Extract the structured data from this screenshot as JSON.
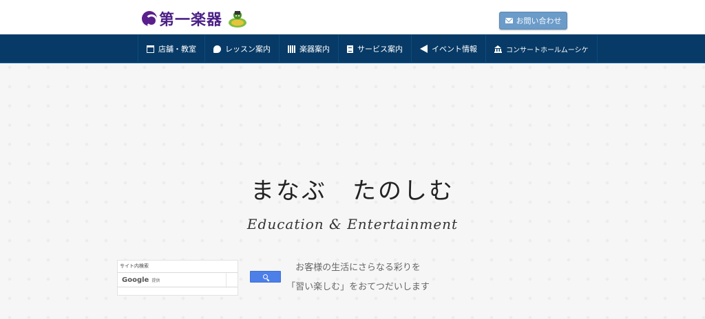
{
  "header": {
    "logo_text": "第一楽器",
    "contact_label": "お問い合わせ"
  },
  "nav": {
    "items": [
      {
        "label": "店舗・教室",
        "icon": "store-icon"
      },
      {
        "label": "レッスン案内",
        "icon": "chat-bubble-icon"
      },
      {
        "label": "楽器案内",
        "icon": "piano-keys-icon"
      },
      {
        "label": "サービス案内",
        "icon": "document-icon"
      },
      {
        "label": "イベント情報",
        "icon": "megaphone-icon"
      },
      {
        "label": "コンサートホールムーシケ",
        "icon": "concert-hall-icon"
      }
    ]
  },
  "hero": {
    "title": "まなぶ　たのしむ",
    "subtitle": "Education & Entertainment",
    "line1": "お客様の生活にさらなる彩りを",
    "line2": "「習い楽しむ」をおてつだいします"
  },
  "search": {
    "caption": "サイト内検索",
    "brand": "Google",
    "provided": "提供"
  },
  "colors": {
    "nav_bg": "#073a66",
    "logo": "#4b1f86",
    "contact_button": "#6b9bc9",
    "search_button": "#4d7fe8"
  }
}
